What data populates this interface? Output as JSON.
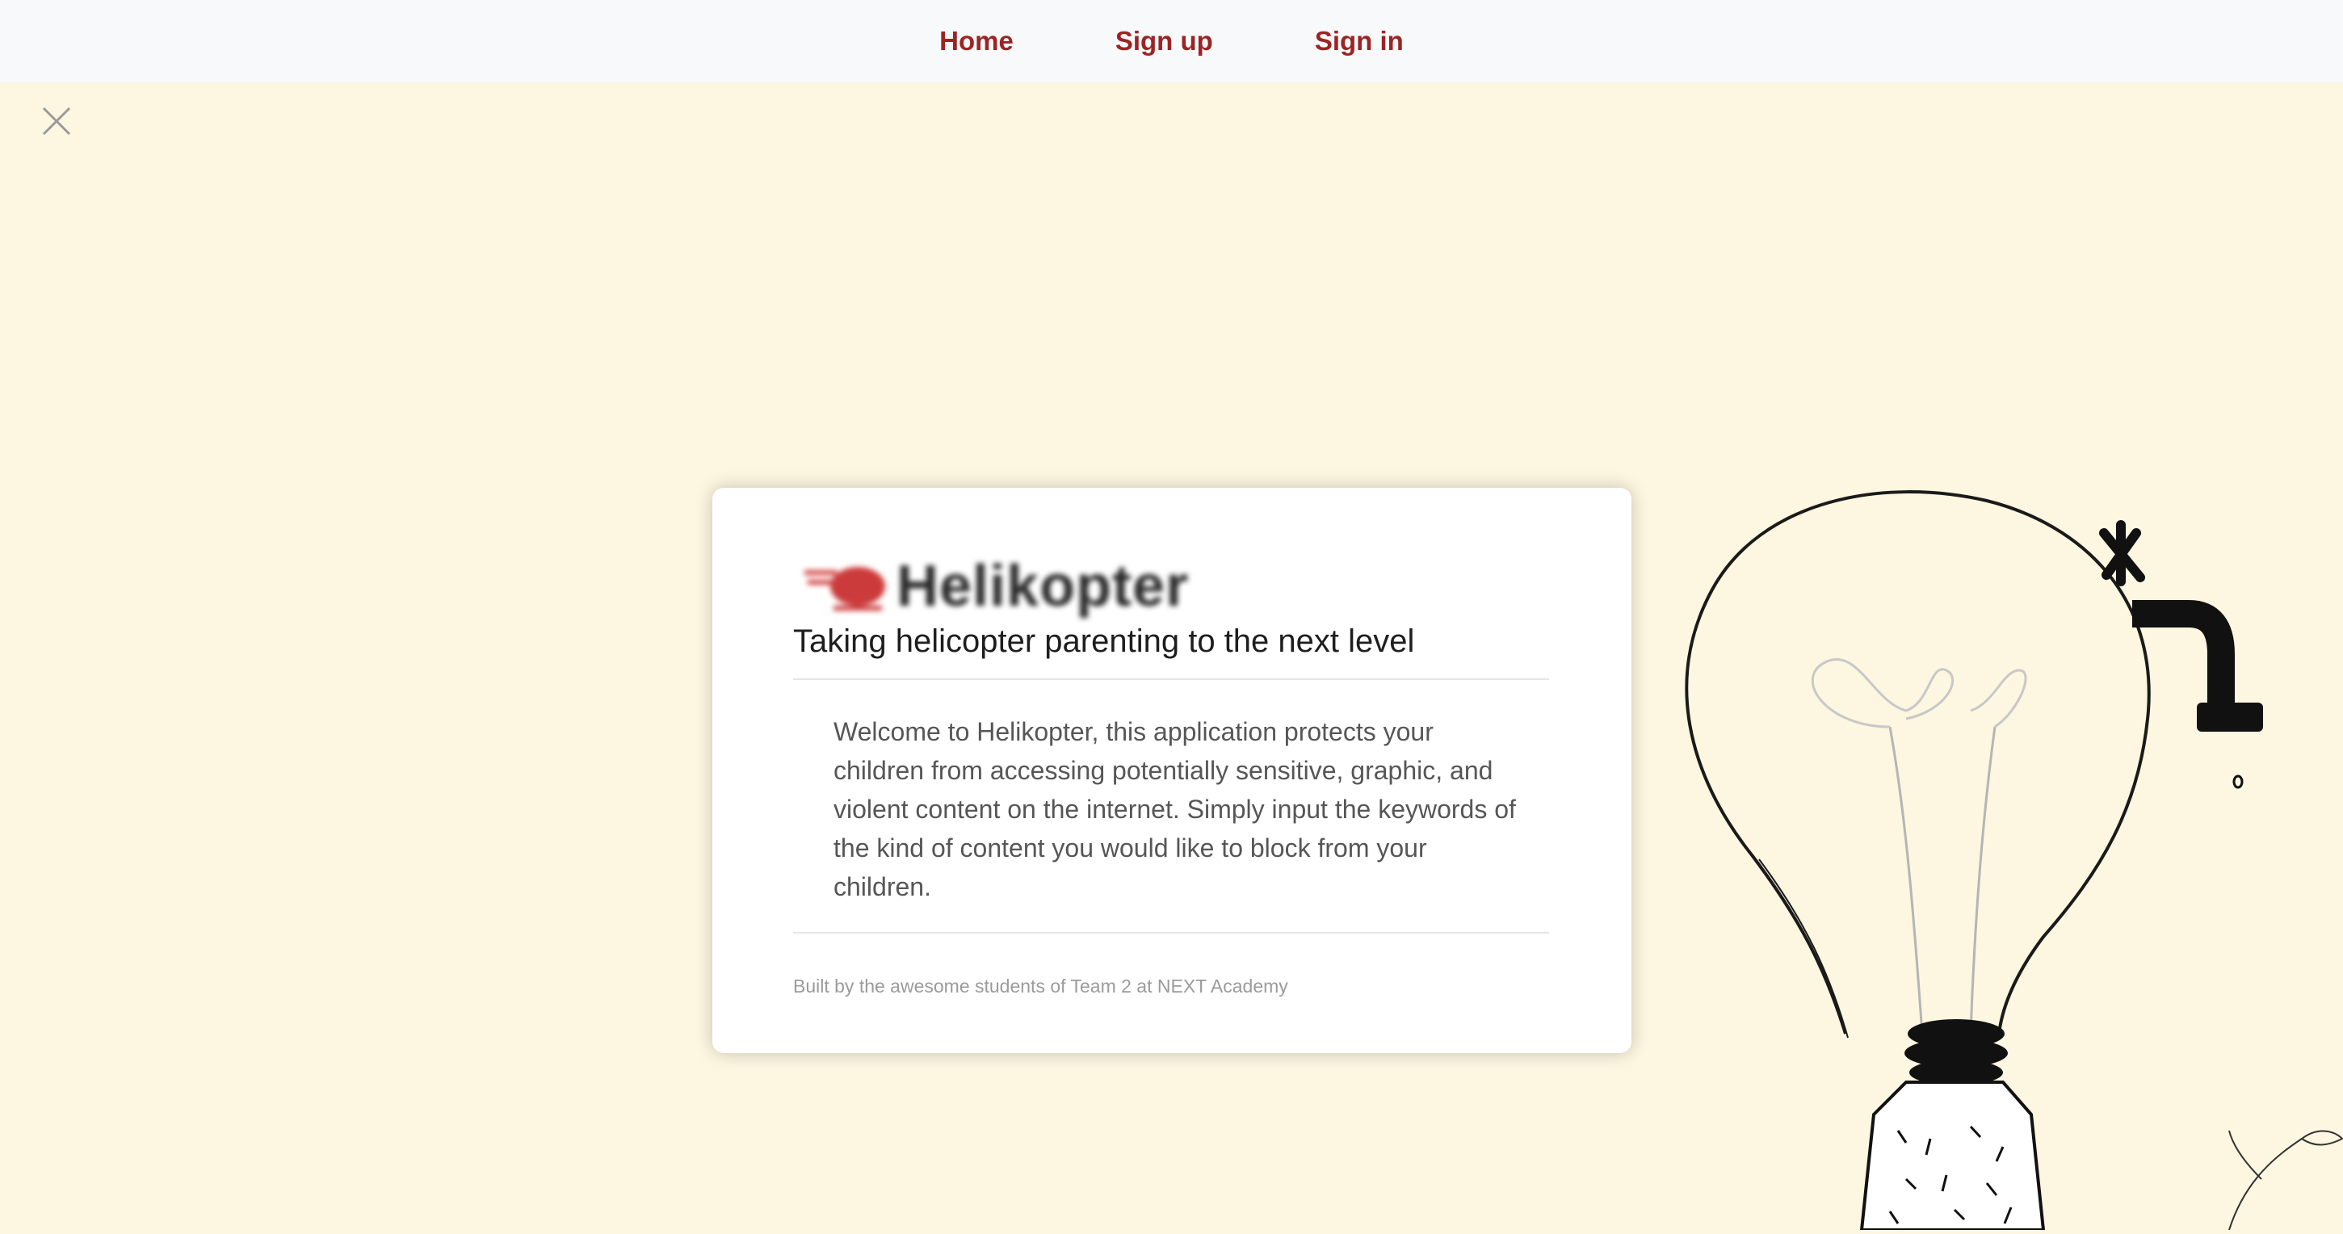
{
  "nav": {
    "home": "Home",
    "signup": "Sign up",
    "signin": "Sign in"
  },
  "close_icon": "close-x-icon",
  "card": {
    "logo_text": "Helikopter",
    "tagline": "Taking helicopter parenting to the next level",
    "description": "Welcome to Helikopter, this application protects your children from accessing potentially sensitive, graphic, and violent content on the internet. Simply input the keywords of the kind of content you would like to block from your children.",
    "footer": "Built by the awesome students of Team 2 at NEXT Academy"
  },
  "illustration": "lightbulb-helicopter-illustration",
  "colors": {
    "accent": "#9c2424",
    "background": "#fdf6e0",
    "nav_bg": "#f8f9fb"
  }
}
